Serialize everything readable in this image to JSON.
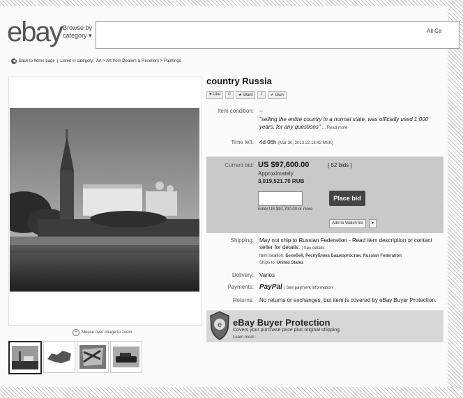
{
  "header": {
    "logo": "ebay",
    "browse_line1": "Browse by",
    "browse_line2": "category ▾",
    "search_placeholder": "",
    "search_category": "All Ca"
  },
  "breadcrumb": {
    "back": "Back to home page",
    "sep": "|",
    "listed_in": "Listed in category:",
    "path": "Art > Art from Dealers & Resellers > Paintings"
  },
  "gallery": {
    "zoom_note": "Mouse over image to zoom",
    "thumbnails": [
      "kremlin-thumb",
      "map-thumb",
      "flag-thumb",
      "car-thumb"
    ]
  },
  "item": {
    "title": "country Russia",
    "like": "Like",
    "like_count": "0",
    "want": "Want",
    "want_count": "1",
    "own": "Own",
    "condition_label": "Item condition:",
    "condition_value": "--",
    "condition_quote": "\"selling the entire country in a normal state, was officially used 1,000 years, for any questions\"",
    "read_more": "... Read more",
    "time_left_label": "Time left:",
    "time_left_value": "4d 06h",
    "time_left_detail": "(Mar 30, 2013  22:18:42 MSK)"
  },
  "bid": {
    "current_label": "Current bid:",
    "price": "US $97,600.00",
    "approx": "Approximately",
    "rub": "3,019,521.70 RUB",
    "bids": "[ 52 bids ]",
    "hint": "Enter US $97,700.00 or more",
    "place_bid": "Place bid",
    "watch_list": "Add to Watch list",
    "watch_dropdown": "▾"
  },
  "shipping": {
    "label": "Shipping:",
    "value": "May not ship to Russian Federation - Read item description or contact seller for details.",
    "see_details": "| See details",
    "location_label": "Item location:",
    "location_value": "Белебей, Республика Башкортостан, Russian Federation",
    "ships_label": "Ships to:",
    "ships_value": "United States"
  },
  "delivery": {
    "label": "Delivery:",
    "value": "Varies"
  },
  "payments": {
    "label": "Payments:",
    "value": "PayPal",
    "link": "| See payment information"
  },
  "returns": {
    "label": "Returns:",
    "value": "No returns or exchanges, but item is covered by eBay Buyer Protection."
  },
  "protection": {
    "title": "eBay Buyer Protection",
    "sub": "Covers your purchase price plus original shipping.",
    "link": "Learn more",
    "shield_letter": "e"
  }
}
